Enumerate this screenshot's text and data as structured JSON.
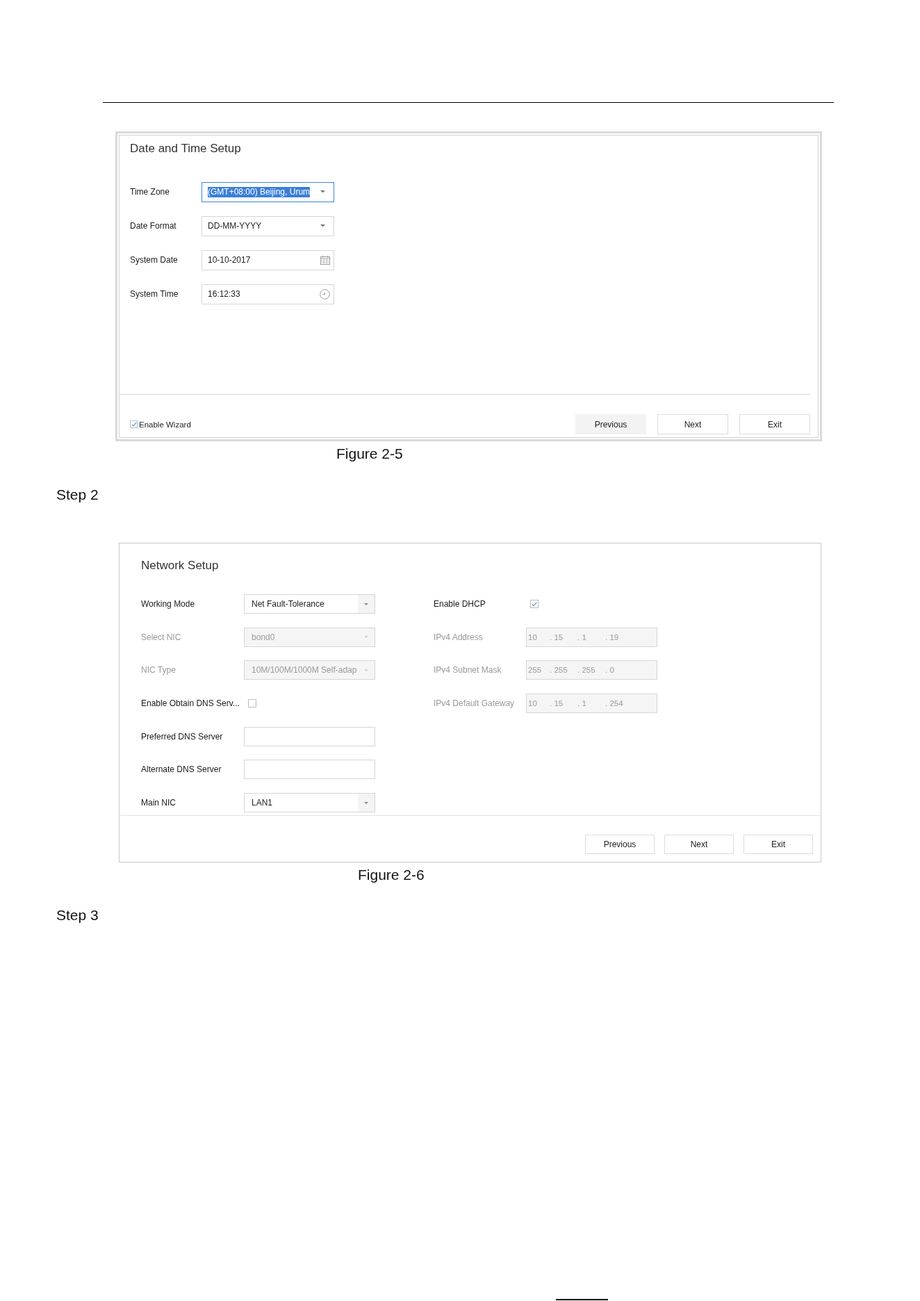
{
  "date_time_dialog": {
    "title": "Date and Time Setup",
    "fields": [
      {
        "label": "Time Zone",
        "kind": "dropdown",
        "value": "(GMT+08:00) Beijing, Urum",
        "focused": true
      },
      {
        "label": "Date Format",
        "kind": "dropdown",
        "value": "DD-MM-YYYY",
        "focused": false
      },
      {
        "label": "System Date",
        "kind": "date",
        "value": "10-10-2017",
        "focused": false
      },
      {
        "label": "System Time",
        "kind": "time",
        "value": "16:12:33",
        "focused": false
      }
    ],
    "wizard_checkbox": {
      "label": "Enable Wizard",
      "checked": true
    },
    "buttons": [
      {
        "label": "Previous",
        "hovered": true
      },
      {
        "label": "Next",
        "hovered": false
      },
      {
        "label": "Exit",
        "hovered": false
      }
    ]
  },
  "date_time_caption": "Figure 2-5",
  "step_heading_a": "Step 2",
  "network_dialog": {
    "title": "Network Setup",
    "left_fields": [
      {
        "label": "Working Mode",
        "kind": "dropdown",
        "value": "Net Fault-Tolerance",
        "disabled": false
      },
      {
        "label": "Select NIC",
        "kind": "dropdown",
        "value": "bond0",
        "disabled": true
      },
      {
        "label": "NIC Type",
        "kind": "dropdown",
        "value": "10M/100M/1000M Self-adap",
        "disabled": true
      },
      {
        "label": "Enable Obtain DNS Serv...",
        "kind": "checkbox",
        "checked": false,
        "disabled": false
      },
      {
        "label": "Preferred DNS Server",
        "kind": "text"
      },
      {
        "label": "Alternate DNS Server",
        "kind": "text"
      },
      {
        "label": "Main NIC",
        "kind": "dropdown",
        "value": "LAN1",
        "disabled": false
      }
    ],
    "right_fields": [
      {
        "label": "Enable DHCP",
        "kind": "checkbox",
        "checked": true,
        "disabled": false
      },
      {
        "label": "IPv4 Address",
        "kind": "ip",
        "octets": [
          "10",
          ". 15",
          ". 1",
          ". 19"
        ],
        "disabled": true
      },
      {
        "label": "IPv4 Subnet Mask",
        "kind": "ip",
        "octets": [
          "255",
          ". 255",
          ". 255",
          ". 0"
        ],
        "disabled": true
      },
      {
        "label": "IPv4 Default Gateway",
        "kind": "ip",
        "octets": [
          "10",
          ". 15",
          ". 1",
          ". 254"
        ],
        "disabled": true
      }
    ],
    "buttons": [
      {
        "label": "Previous",
        "hovered": false
      },
      {
        "label": "Next",
        "hovered": false
      },
      {
        "label": "Exit",
        "hovered": false
      }
    ]
  },
  "network_caption": "Figure 2-6",
  "step_heading_b": "Step 3"
}
